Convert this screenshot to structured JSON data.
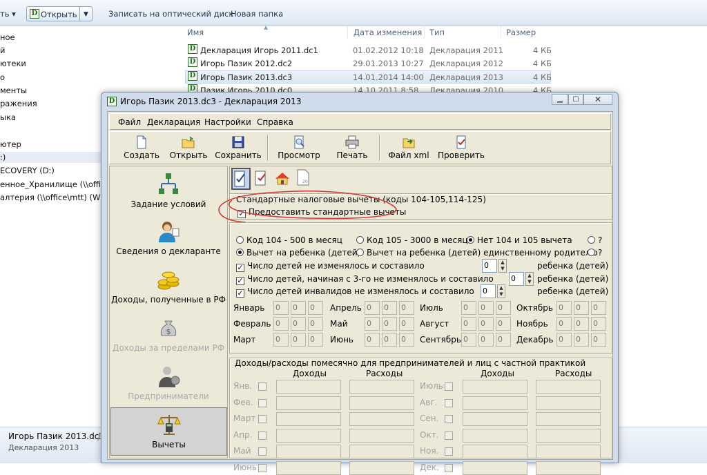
{
  "explorer": {
    "toolbar": {
      "arrange_label": "ть ▾",
      "open_label": "Открыть",
      "burn_label": "Записать на оптический диск",
      "new_folder_label": "Новая папка"
    },
    "nav": [
      "ное",
      "й",
      "ютеки",
      "о",
      "менты",
      "ражения",
      "ыка",
      "ютер",
      ":)",
      "ECOVERY (D:)",
      "енное_Хранилище (\\\\office\\r",
      "алтерия (\\\\office\\mtt) (W:)"
    ],
    "columns": {
      "name": "Имя",
      "date": "Дата изменения",
      "type": "Тип",
      "size": "Размер"
    },
    "files": [
      {
        "name": "Декларация Игорь 2011.dc1",
        "date": "01.02.2012 10:18",
        "type": "Декларация 2011",
        "size": "4 КБ"
      },
      {
        "name": "Игорь Пазик 2012.dc2",
        "date": "29.01.2013 10:27",
        "type": "Декларация 2012",
        "size": "4 КБ"
      },
      {
        "name": "Игорь Пазик 2013.dc3",
        "date": "14.01.2014 14:00",
        "type": "Декларация 2013",
        "size": "4 КБ"
      },
      {
        "name": "Пазик Игорь 2010.dc0",
        "date": "14.10.2011 8:58",
        "type": "Декларация 2010",
        "size": "4 КБ"
      }
    ],
    "status": {
      "filename": "Игорь Пазик 2013.dc3",
      "extra": "Д",
      "filetype": "Декларация 2013"
    }
  },
  "app": {
    "title": "Игорь Пазик 2013.dc3 - Декларация 2013",
    "menu": [
      "Файл",
      "Декларация",
      "Настройки",
      "Справка"
    ],
    "toolbar": [
      {
        "label": "Создать",
        "icon": "new-document-icon"
      },
      {
        "label": "Открыть",
        "icon": "open-folder-icon"
      },
      {
        "label": "Сохранить",
        "icon": "save-disk-icon"
      },
      {
        "label": "Просмотр",
        "icon": "print-preview-icon"
      },
      {
        "label": "Печать",
        "icon": "printer-icon"
      },
      {
        "label": "Файл xml",
        "icon": "xml-export-icon"
      },
      {
        "label": "Проверить",
        "icon": "check-icon"
      }
    ],
    "left_nav": [
      {
        "label": "Задание условий",
        "enabled": true
      },
      {
        "label": "Сведения о декларанте",
        "enabled": true
      },
      {
        "label": "Доходы, полученные в РФ",
        "enabled": true
      },
      {
        "label": "Доходы за пределами РФ",
        "enabled": false
      },
      {
        "label": "Предприниматели",
        "enabled": false
      },
      {
        "label": "Вычеты",
        "enabled": true,
        "active": true
      }
    ],
    "deductions": {
      "group_title": "Стандартные налоговые вычеты (коды 104-105,114-125)",
      "provide_label": "Предоставить стандартные вычеты",
      "provide_checked": true,
      "radio_row1": [
        {
          "label": "Код 104 - 500 в месяц",
          "checked": false
        },
        {
          "label": "Код 105 - 3000 в месяц",
          "checked": false
        },
        {
          "label": "Нет 104 и 105 вычета",
          "checked": true
        },
        {
          "label": "?",
          "checked": false
        }
      ],
      "radio_row2": [
        {
          "label": "Вычет на ребенка (детей)",
          "checked": true
        },
        {
          "label": "Вычет на ребенка (детей) единственному родителю",
          "checked": false
        },
        {
          "label": "?",
          "checked": false
        }
      ],
      "children": [
        {
          "label": "Число детей не изменялось и составило",
          "value": "0",
          "suffix": "ребенка (детей)"
        },
        {
          "label": "Число детей, начиная с 3-го не изменялось и составило",
          "value": "0",
          "suffix": "ребенка (детей)"
        },
        {
          "label": "Число детей инвалидов не изменялось и составило",
          "value": "0",
          "suffix": "ребенка (детей)"
        }
      ],
      "months": [
        [
          "Январь",
          "Апрель",
          "Июль",
          "Октябрь"
        ],
        [
          "Февраль",
          "Май",
          "Август",
          "Ноябрь"
        ],
        [
          "Март",
          "Июнь",
          "Сентябрь",
          "Декабрь"
        ]
      ],
      "cell_value": "0"
    },
    "business": {
      "group_title": "Доходы/расходы помесячно для предпринимателей и лиц с частной практикой",
      "col_income": "Доходы",
      "col_expense": "Расходы",
      "left_months": [
        "Янв.",
        "Фев.",
        "Март",
        "Апр.",
        "Май",
        "Июнь"
      ],
      "right_months": [
        "Июль",
        "Авг.",
        "Сен.",
        "Окт.",
        "Ноя.",
        "Дек."
      ]
    },
    "colors": {
      "annotation": "#d23a3a",
      "active_nav": "#d3d3d3",
      "window_bg": "#ece9d8"
    }
  }
}
